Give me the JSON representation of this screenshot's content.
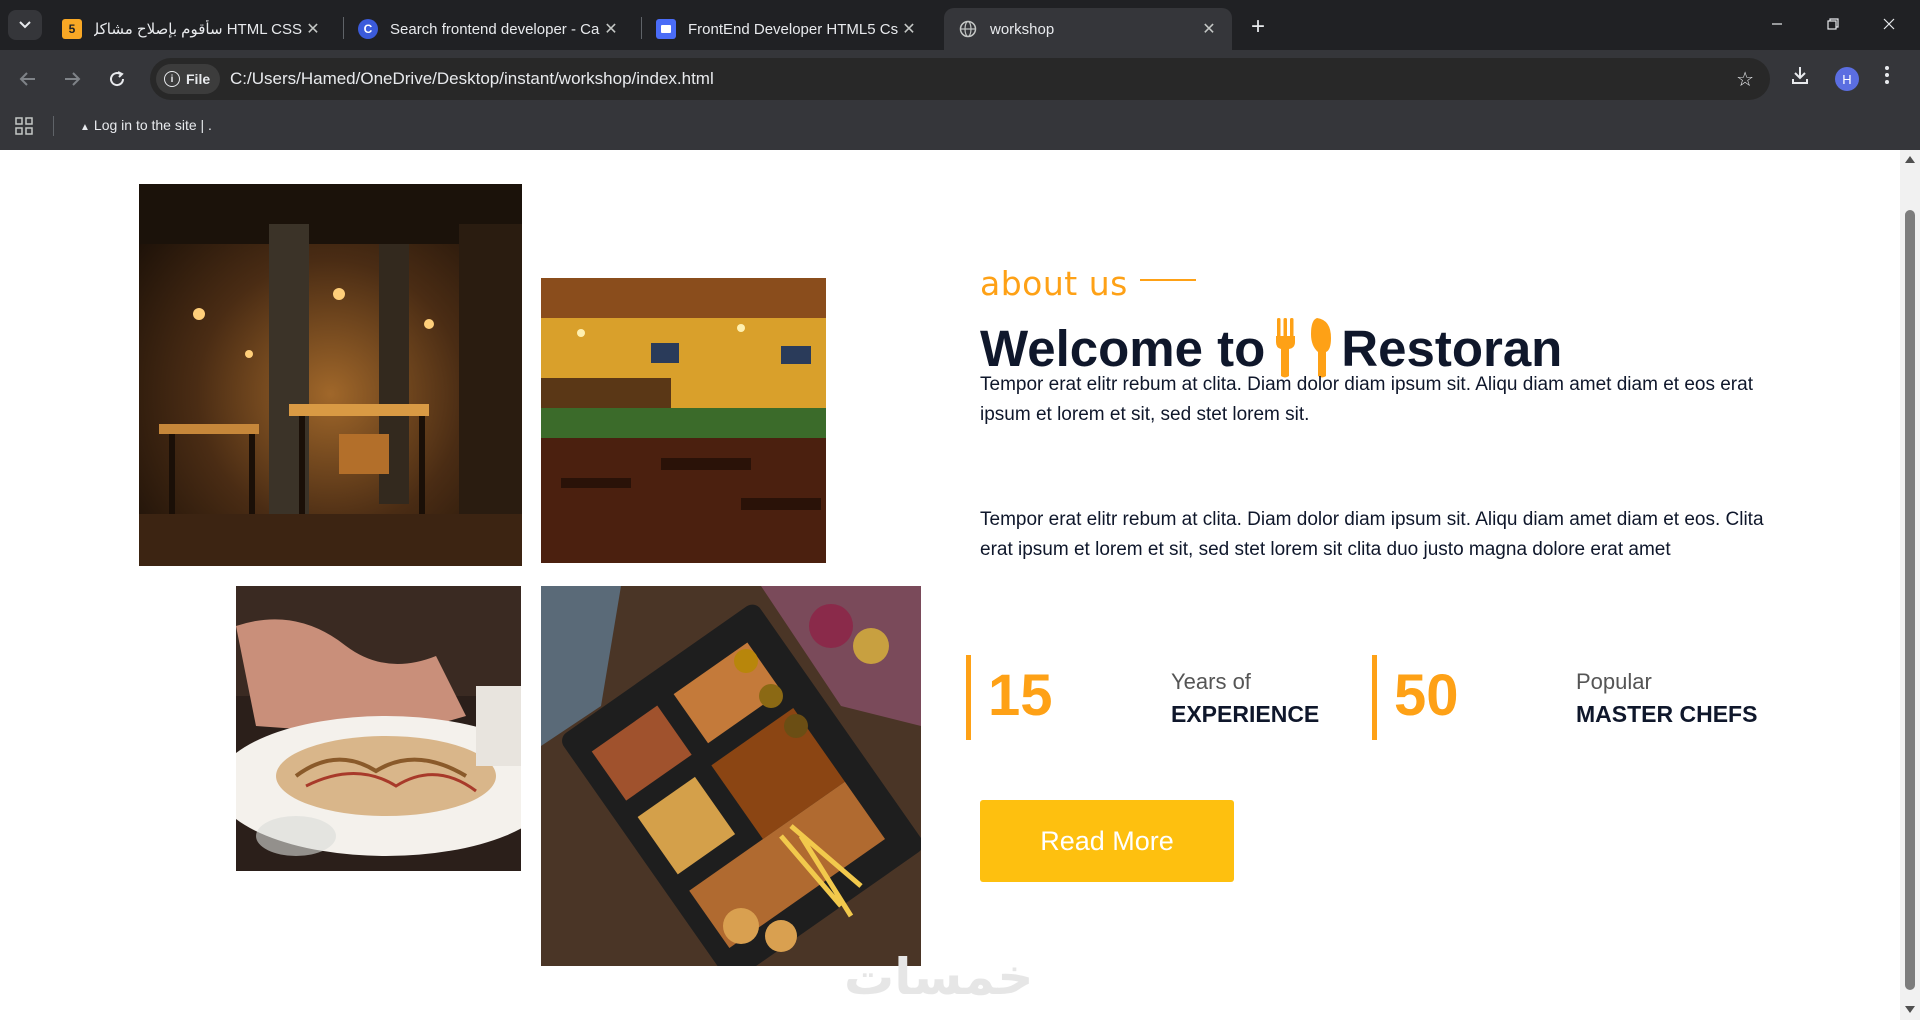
{
  "browser": {
    "tabs": [
      {
        "title": "HTML CSS سأقوم بإصلاح مشاكل",
        "favicon": "5"
      },
      {
        "title": "Search frontend developer - Ca",
        "favicon": "C"
      },
      {
        "title": "FrontEnd Developer HTML5 Css",
        "favicon": ""
      },
      {
        "title": "workshop",
        "favicon": ""
      }
    ],
    "url_chip": "File",
    "url": "C:/Users/Hamed/OneDrive/Desktop/instant/workshop/index.html",
    "bookmark": "Log in to the site | .",
    "avatar_initial": "H"
  },
  "about": {
    "label": "about us",
    "heading_before": "Welcome to",
    "heading_after": "Restoran",
    "paragraph_1": "Tempor erat elitr rebum at clita. Diam dolor diam ipsum sit. Aliqu diam amet diam et eos erat ipsum et lorem et sit, sed stet lorem sit.",
    "paragraph_2": "Tempor erat elitr rebum at clita. Diam dolor diam ipsum sit. Aliqu diam amet diam et eos. Clita erat ipsum et lorem et sit, sed stet lorem sit clita duo justo magna dolore erat amet"
  },
  "stats": [
    {
      "number": "15",
      "label_top": "Years of",
      "label_bottom": "EXPERIENCE"
    },
    {
      "number": "50",
      "label_top": "Popular",
      "label_bottom": "MASTER CHEFS"
    }
  ],
  "read_more": "Read More",
  "watermark": "خمسات",
  "colors": {
    "accent": "#fea116",
    "button": "#fec00f",
    "dark": "#0f172b"
  }
}
